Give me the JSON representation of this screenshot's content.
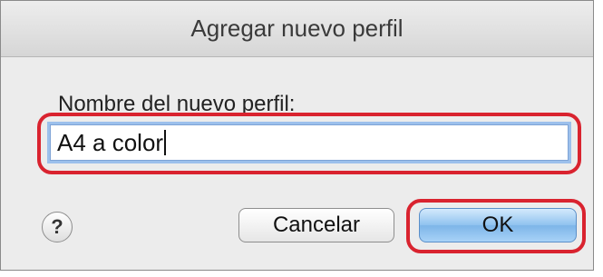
{
  "dialog": {
    "title": "Agregar nuevo perfil",
    "field_label": "Nombre del nuevo perfil:",
    "field_value": "A4 a color"
  },
  "buttons": {
    "help_label": "?",
    "cancel_label": "Cancelar",
    "ok_label": "OK"
  },
  "highlight_color": "#d9232f"
}
